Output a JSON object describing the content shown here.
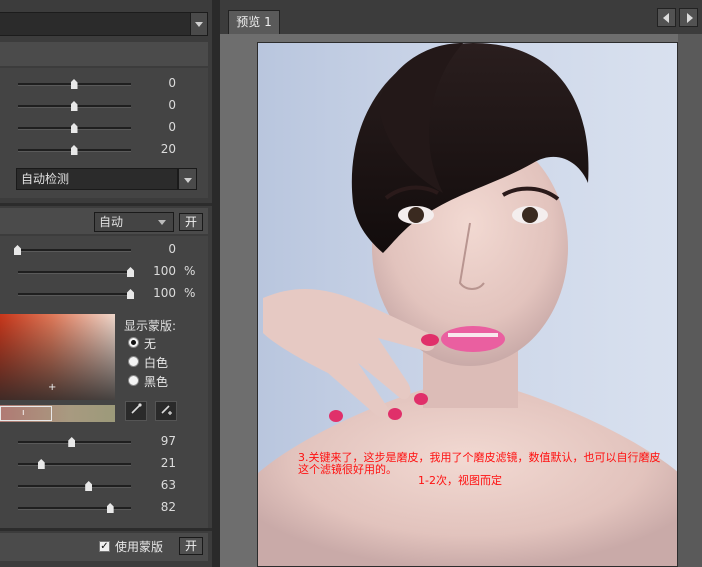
{
  "left_panel": {
    "sliders_group1": [
      {
        "value": "0",
        "pos": 0.5
      },
      {
        "value": "0",
        "pos": 0.5
      },
      {
        "value": "0",
        "pos": 0.5
      },
      {
        "value": "20",
        "pos": 0.5
      }
    ],
    "detect_combo": "自动检测",
    "mode_combo": "自动",
    "on_button_label": "开",
    "sliders_group2": [
      {
        "value": "0",
        "unit": "",
        "pos": 0.0
      },
      {
        "value": "100",
        "unit": "%",
        "pos": 1.0
      },
      {
        "value": "100",
        "unit": "%",
        "pos": 1.0
      }
    ],
    "mask": {
      "title": "显示蒙版:",
      "options": [
        "无",
        "白色",
        "黑色"
      ],
      "selected": "无"
    },
    "sliders_group3": [
      {
        "value": "97",
        "pos": 0.47
      },
      {
        "value": "21",
        "pos": 0.2
      },
      {
        "value": "63",
        "pos": 0.63
      },
      {
        "value": "82",
        "pos": 0.82
      }
    ],
    "use_mask_label": "使用蒙版",
    "use_mask_checked": true,
    "bottom_on_button_label": "开"
  },
  "preview": {
    "tab_label": "预览 1"
  },
  "annotations": {
    "line1": "3.关键来了，这步是磨皮，我用了个磨皮滤镜，数值默认，也可以自行磨皮",
    "line2": "这个滤镜很好用的。",
    "line3": "1-2次，视图而定"
  },
  "colors": {
    "annotation_red": "#ff1010",
    "panel_bg": "#3c3c3c",
    "nail_pink": "#e0306a"
  }
}
